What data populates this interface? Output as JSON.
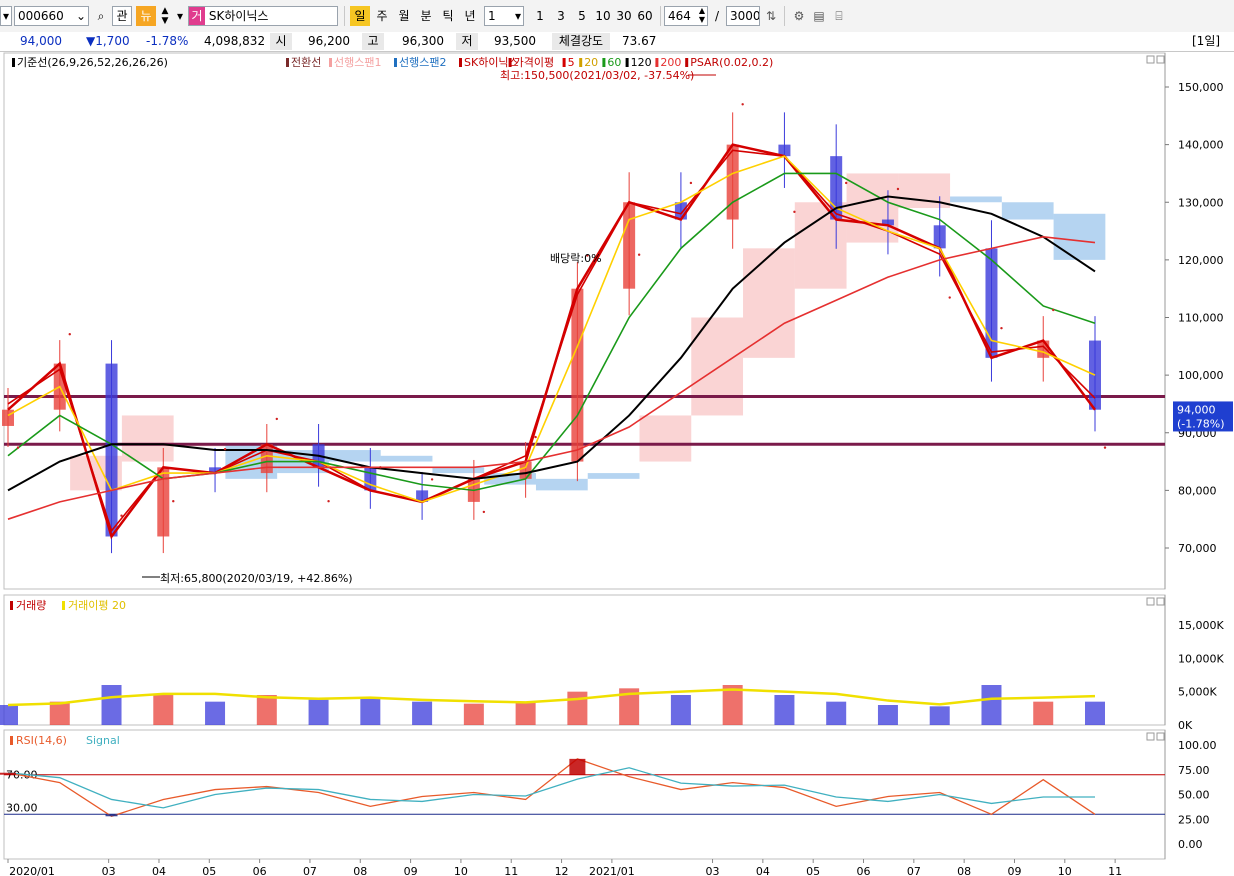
{
  "toolbar": {
    "code": "000660",
    "kwan_label": "관",
    "new_label": "뉴",
    "type_badge": "거",
    "name": "SK하이닉스",
    "periods": [
      "일",
      "주",
      "월",
      "분",
      "틱",
      "년"
    ],
    "interval": "1",
    "minutes": [
      "1",
      "3",
      "5",
      "10",
      "30",
      "60"
    ],
    "count": "464",
    "count_sep": "/",
    "total": "3000"
  },
  "quote": {
    "price": "94,000",
    "change": "▼1,700",
    "change_pct": "-1.78%",
    "volume": "4,098,832",
    "open_label": "시",
    "open": "96,200",
    "high_label": "고",
    "high": "96,300",
    "low_label": "저",
    "low": "93,500",
    "strength_label": "체결강도",
    "strength": "73.67",
    "period_tag": "[1일]"
  },
  "price_panel": {
    "legend": [
      "기준선(26,9,26,52,26,26,26)",
      "전환선",
      "선행스팬1",
      "선행스팬2",
      "SK하이닉스",
      "가격이평",
      "5",
      "20",
      "60",
      "120",
      "200",
      "PSAR(0.02,0.2)"
    ],
    "high_note": "최고:150,500(2021/03/02, -37.54%)",
    "low_note": "최저:65,800(2020/03/19, +42.86%)",
    "dividend_note": "배당락:0%",
    "last_price_tag": "94,000",
    "last_change_tag": "(-1.78%)",
    "y_ticks": [
      "150,000",
      "140,000",
      "130,000",
      "120,000",
      "110,000",
      "100,000",
      "90,000",
      "80,000",
      "70,000"
    ]
  },
  "volume_panel": {
    "legend": [
      "거래량",
      "거래이평 20"
    ],
    "y_ticks": [
      "15,000K",
      "10,000K",
      "5,000K",
      "0K"
    ]
  },
  "rsi_panel": {
    "legend": [
      "RSI(14,6)",
      "Signal"
    ],
    "y_ticks": [
      "100.00",
      "75.00",
      "50.00",
      "25.00",
      "0.00"
    ],
    "level_high": "70.00",
    "level_low": "30.00"
  },
  "x_labels": [
    "2020/01",
    "03",
    "04",
    "05",
    "06",
    "07",
    "08",
    "09",
    "10",
    "11",
    "12",
    "2021/01",
    "03",
    "04",
    "05",
    "06",
    "07",
    "08",
    "09",
    "10",
    "11"
  ],
  "colors": {
    "up": "#e8413a",
    "down": "#3a3adb",
    "ma5": "#d40000",
    "ma20": "#ffd000",
    "ma60": "#1a9a1a",
    "ma120": "#000000",
    "ma200": "#e53030",
    "span1": "#f4a0a0",
    "span2": "#5aa0e0",
    "support": "#7a1a4a"
  },
  "chart_data": {
    "type": "line",
    "title": "SK하이닉스",
    "x": [
      "2020-01",
      "2020-02",
      "2020-03",
      "2020-04",
      "2020-05",
      "2020-06",
      "2020-07",
      "2020-08",
      "2020-09",
      "2020-10",
      "2020-11",
      "2020-12",
      "2021-01",
      "2021-02",
      "2021-03",
      "2021-04",
      "2021-05",
      "2021-06",
      "2021-07",
      "2021-08",
      "2021-09",
      "2021-10"
    ],
    "series": [
      {
        "name": "SK하이닉스",
        "values": [
          94000,
          102000,
          72000,
          84000,
          83000,
          88000,
          84000,
          80000,
          78000,
          82000,
          85000,
          115000,
          130000,
          127000,
          140000,
          138000,
          127000,
          126000,
          122000,
          103000,
          106000,
          94000
        ]
      },
      {
        "name": "5",
        "values": [
          95000,
          101000,
          73000,
          84000,
          83000,
          87000,
          85000,
          80000,
          78000,
          82000,
          86000,
          114000,
          130000,
          128000,
          139000,
          138000,
          128000,
          125000,
          121000,
          104000,
          105000,
          96000
        ]
      },
      {
        "name": "20",
        "values": [
          93000,
          98000,
          80000,
          83000,
          83000,
          86000,
          85000,
          81000,
          78000,
          81000,
          84000,
          105000,
          127000,
          130000,
          135000,
          138000,
          129000,
          125000,
          122000,
          106000,
          104000,
          100000
        ]
      },
      {
        "name": "60",
        "values": [
          86000,
          93000,
          88000,
          82000,
          83000,
          85000,
          85000,
          83000,
          81000,
          80000,
          82000,
          93000,
          110000,
          122000,
          130000,
          135000,
          135000,
          130000,
          127000,
          120000,
          112000,
          109000
        ]
      },
      {
        "name": "120",
        "values": [
          80000,
          85000,
          88000,
          88000,
          87000,
          87000,
          86000,
          84000,
          83000,
          82000,
          83000,
          85000,
          93000,
          103000,
          115000,
          123000,
          129000,
          131000,
          130000,
          128000,
          124000,
          118000
        ]
      },
      {
        "name": "200",
        "values": [
          75000,
          78000,
          80000,
          82000,
          83000,
          84000,
          84000,
          84000,
          84000,
          84000,
          85000,
          87000,
          91000,
          97000,
          103000,
          109000,
          113000,
          117000,
          120000,
          122000,
          124000,
          123000
        ]
      }
    ],
    "volume": {
      "name": "거래량",
      "x": [
        "2020-01",
        "2020-02",
        "2020-03",
        "2020-04",
        "2020-05",
        "2020-06",
        "2020-07",
        "2020-08",
        "2020-09",
        "2020-10",
        "2020-11",
        "2020-12",
        "2021-01",
        "2021-02",
        "2021-03",
        "2021-04",
        "2021-05",
        "2021-06",
        "2021-07",
        "2021-08",
        "2021-09",
        "2021-10"
      ],
      "values": [
        3000,
        3500,
        6000,
        4500,
        3500,
        4500,
        3800,
        4000,
        3500,
        3200,
        3500,
        5000,
        5500,
        4500,
        6000,
        4500,
        3500,
        3000,
        2800,
        6000,
        3500,
        3500
      ],
      "ma20_name": "거래이평 20"
    },
    "rsi": {
      "name": "RSI(14,6)",
      "x": [
        "2020-01",
        "2020-02",
        "2020-03",
        "2020-04",
        "2020-05",
        "2020-06",
        "2020-07",
        "2020-08",
        "2020-09",
        "2020-10",
        "2020-11",
        "2020-12",
        "2021-01",
        "2021-02",
        "2021-03",
        "2021-04",
        "2021-05",
        "2021-06",
        "2021-07",
        "2021-08",
        "2021-09",
        "2021-10"
      ],
      "values": [
        72,
        62,
        28,
        45,
        55,
        58,
        52,
        38,
        48,
        52,
        45,
        86,
        68,
        55,
        62,
        57,
        38,
        48,
        52,
        30,
        65,
        30
      ]
    },
    "ylim": [
      62000,
      155000
    ],
    "xlabel": "",
    "ylabel": "",
    "grid": false,
    "legend": "top-left"
  }
}
